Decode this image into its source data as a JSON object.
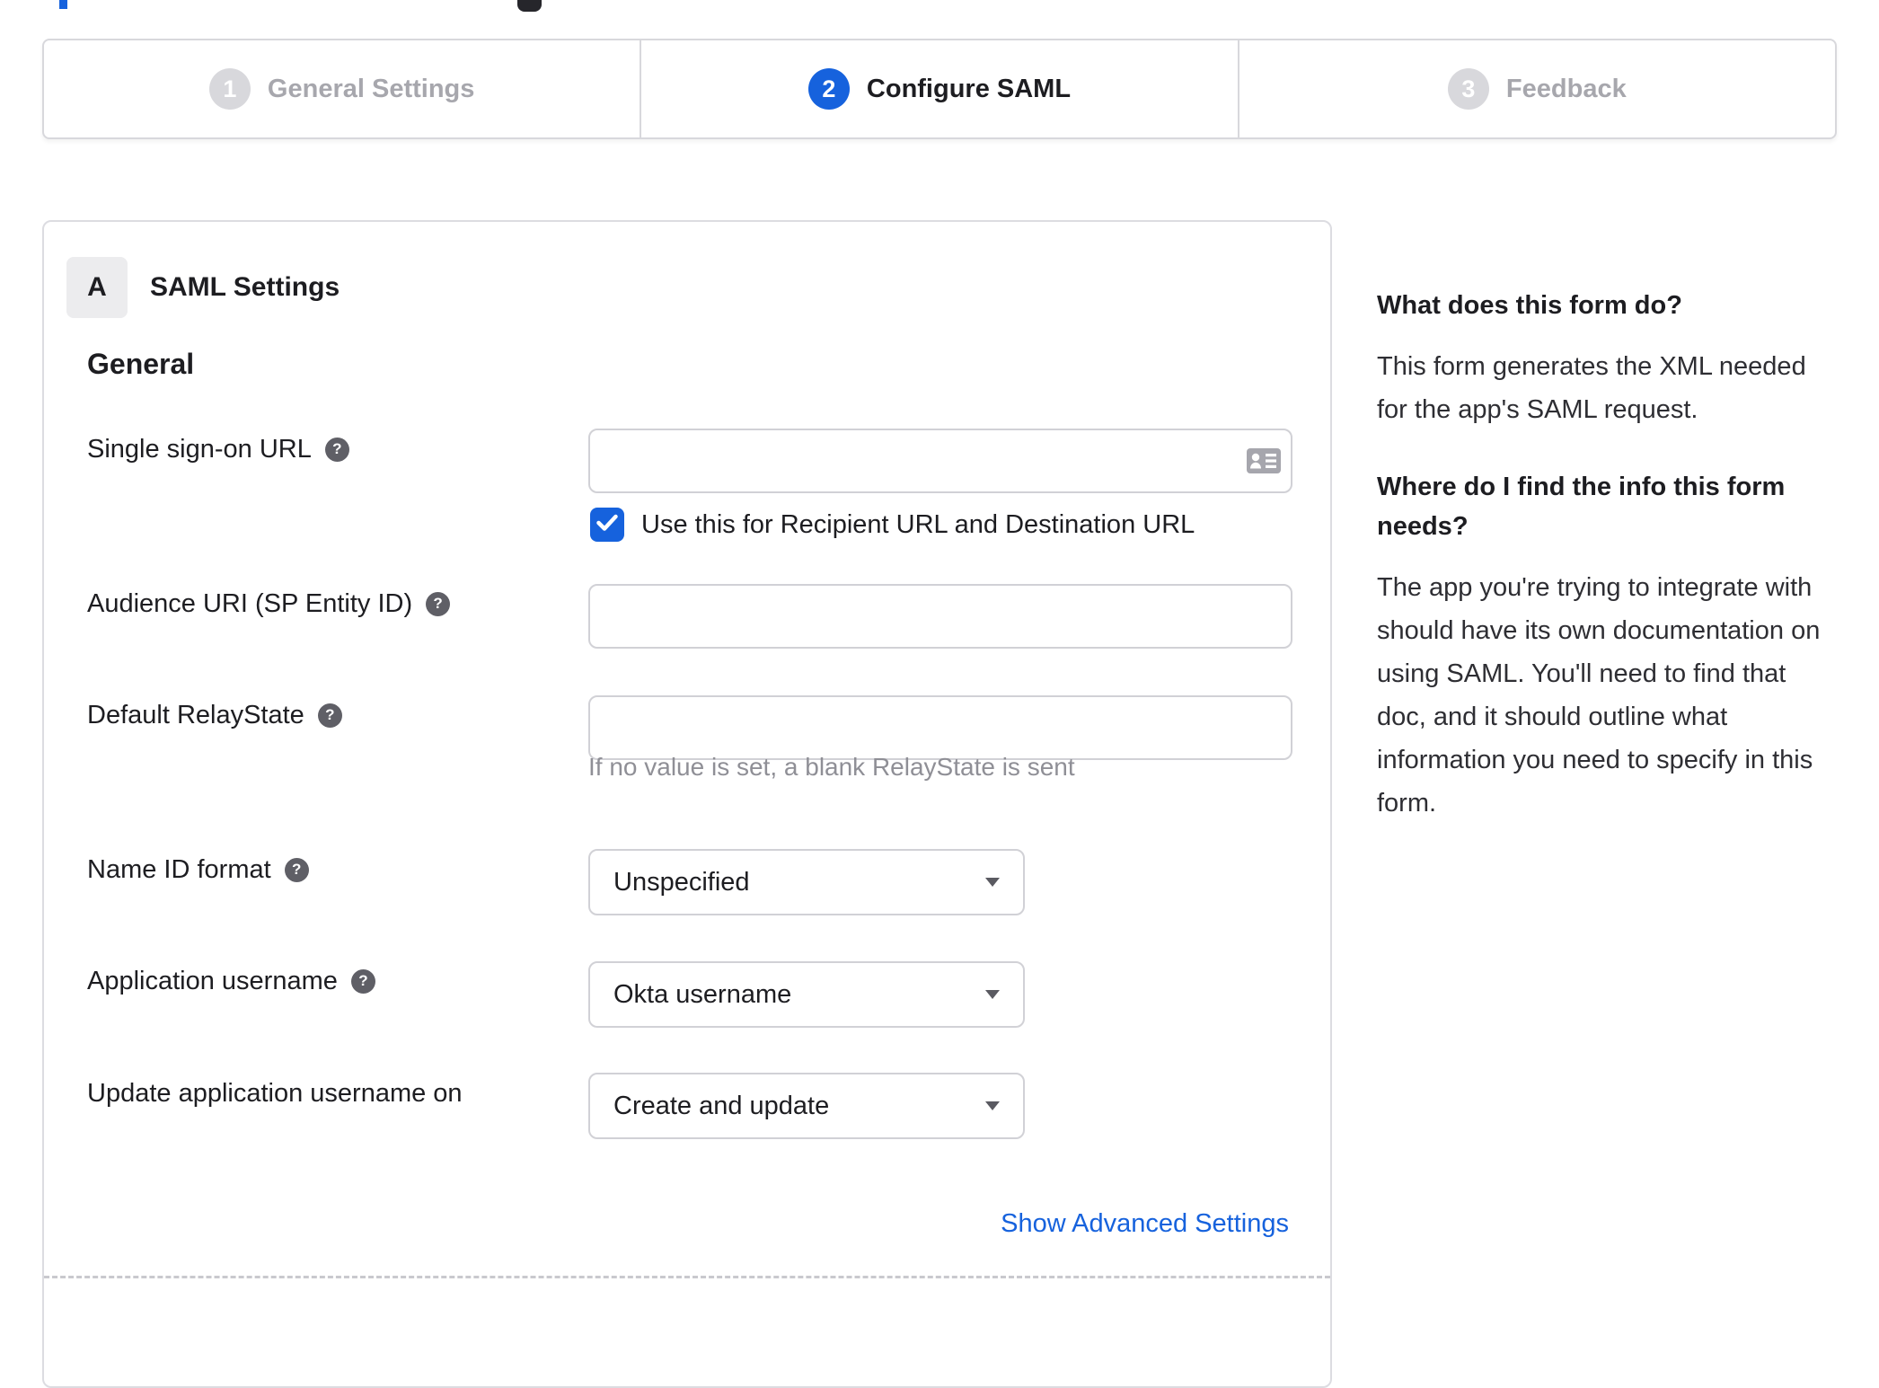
{
  "stepper": {
    "steps": [
      {
        "number": "1",
        "label": "General Settings",
        "state": "inactive"
      },
      {
        "number": "2",
        "label": "Configure SAML",
        "state": "active"
      },
      {
        "number": "3",
        "label": "Feedback",
        "state": "inactive"
      }
    ]
  },
  "panel": {
    "section_badge": "A",
    "section_title": "SAML Settings",
    "subsection_title": "General",
    "fields": {
      "sso": {
        "label": "Single sign-on URL",
        "value": "",
        "checkbox_label": "Use this for Recipient URL and Destination URL",
        "checkbox_checked": true
      },
      "audience": {
        "label": "Audience URI (SP Entity ID)",
        "value": ""
      },
      "relay": {
        "label": "Default RelayState",
        "value": "",
        "helper": "If no value is set, a blank RelayState is sent"
      },
      "name_id": {
        "label": "Name ID format",
        "value": "Unspecified"
      },
      "app_username": {
        "label": "Application username",
        "value": "Okta username"
      },
      "update_username": {
        "label": "Update application username on",
        "value": "Create and update"
      }
    },
    "advanced_link": "Show Advanced Settings"
  },
  "sidebar": {
    "sections": [
      {
        "heading": "What does this form do?",
        "body": "This form generates the XML needed for the app's SAML request."
      },
      {
        "heading": "Where do I find the info this form needs?",
        "body": "The app you're trying to integrate with should have its own documentation on using SAML. You'll need to find that doc, and it should outline what information you need to specify in this form."
      }
    ]
  },
  "colors": {
    "accent_blue": "#1662dd",
    "inactive_grey": "#d8d8dc",
    "text_dark": "#1d1d21",
    "helper_grey": "#8f8f96",
    "border_grey": "#d1d1d6"
  }
}
